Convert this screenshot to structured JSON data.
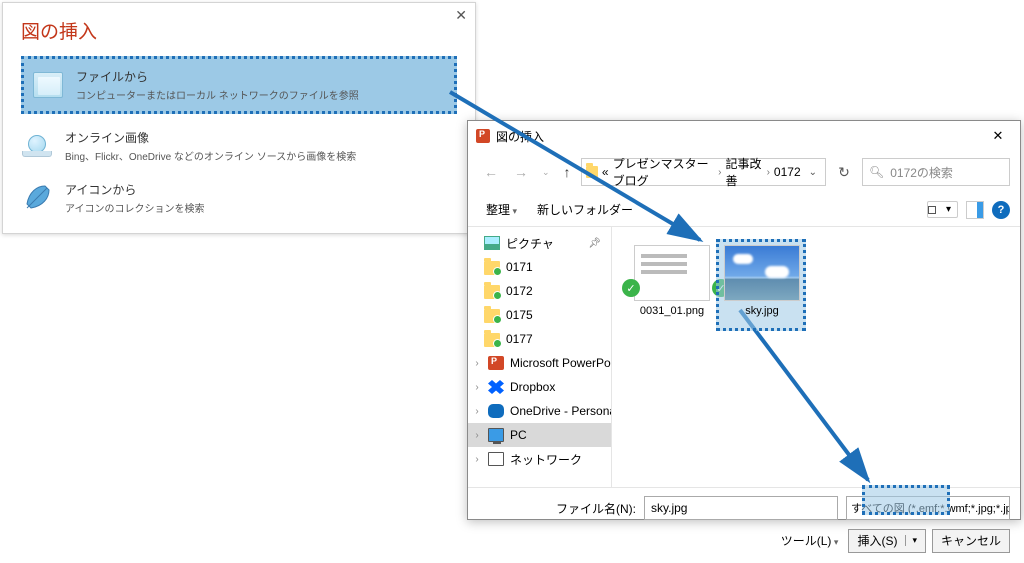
{
  "insert_panel": {
    "title": "図の挿入",
    "options": [
      {
        "title": "ファイルから",
        "desc": "コンピューターまたはローカル ネットワークのファイルを参照"
      },
      {
        "title": "オンライン画像",
        "desc": "Bing、Flickr、OneDrive などのオンライン ソースから画像を検索"
      },
      {
        "title": "アイコンから",
        "desc": "アイコンのコレクションを検索"
      }
    ]
  },
  "file_dialog": {
    "title": "図の挿入",
    "breadcrumb": {
      "prefix": "«",
      "parts": [
        "プレゼンマスターブログ",
        "記事改善",
        "0172"
      ]
    },
    "search_placeholder": "0172の検索",
    "toolbar": {
      "organize": "整理",
      "new_folder": "新しいフォルダー"
    },
    "tree": [
      {
        "icon": "pic",
        "label": "ピクチャ",
        "pinned": true
      },
      {
        "icon": "folder-dot",
        "label": "0171"
      },
      {
        "icon": "folder-dot",
        "label": "0172"
      },
      {
        "icon": "folder-dot",
        "label": "0175"
      },
      {
        "icon": "folder-dot",
        "label": "0177"
      },
      {
        "icon": "pp",
        "label": "Microsoft PowerPoint",
        "expandable": true,
        "outdent": true
      },
      {
        "icon": "dbx",
        "label": "Dropbox",
        "expandable": true,
        "outdent": true
      },
      {
        "icon": "od",
        "label": "OneDrive - Personal",
        "expandable": true,
        "outdent": true
      },
      {
        "icon": "pc",
        "label": "PC",
        "expandable": true,
        "outdent": true,
        "selected": true
      },
      {
        "icon": "net",
        "label": "ネットワーク",
        "expandable": true,
        "outdent": true
      }
    ],
    "files": [
      {
        "name": "0031_01.png",
        "thumb": "text",
        "checked": true
      },
      {
        "name": "sky.jpg",
        "thumb": "sky",
        "checked": true,
        "selected": true
      }
    ],
    "filename_label": "ファイル名(N):",
    "filename_value": "sky.jpg",
    "filter": "すべての図 (*.emf;*.wmf;*.jpg;*.jp",
    "tools": "ツール(L)",
    "insert_btn": "挿入(S)",
    "cancel_btn": "キャンセル"
  }
}
